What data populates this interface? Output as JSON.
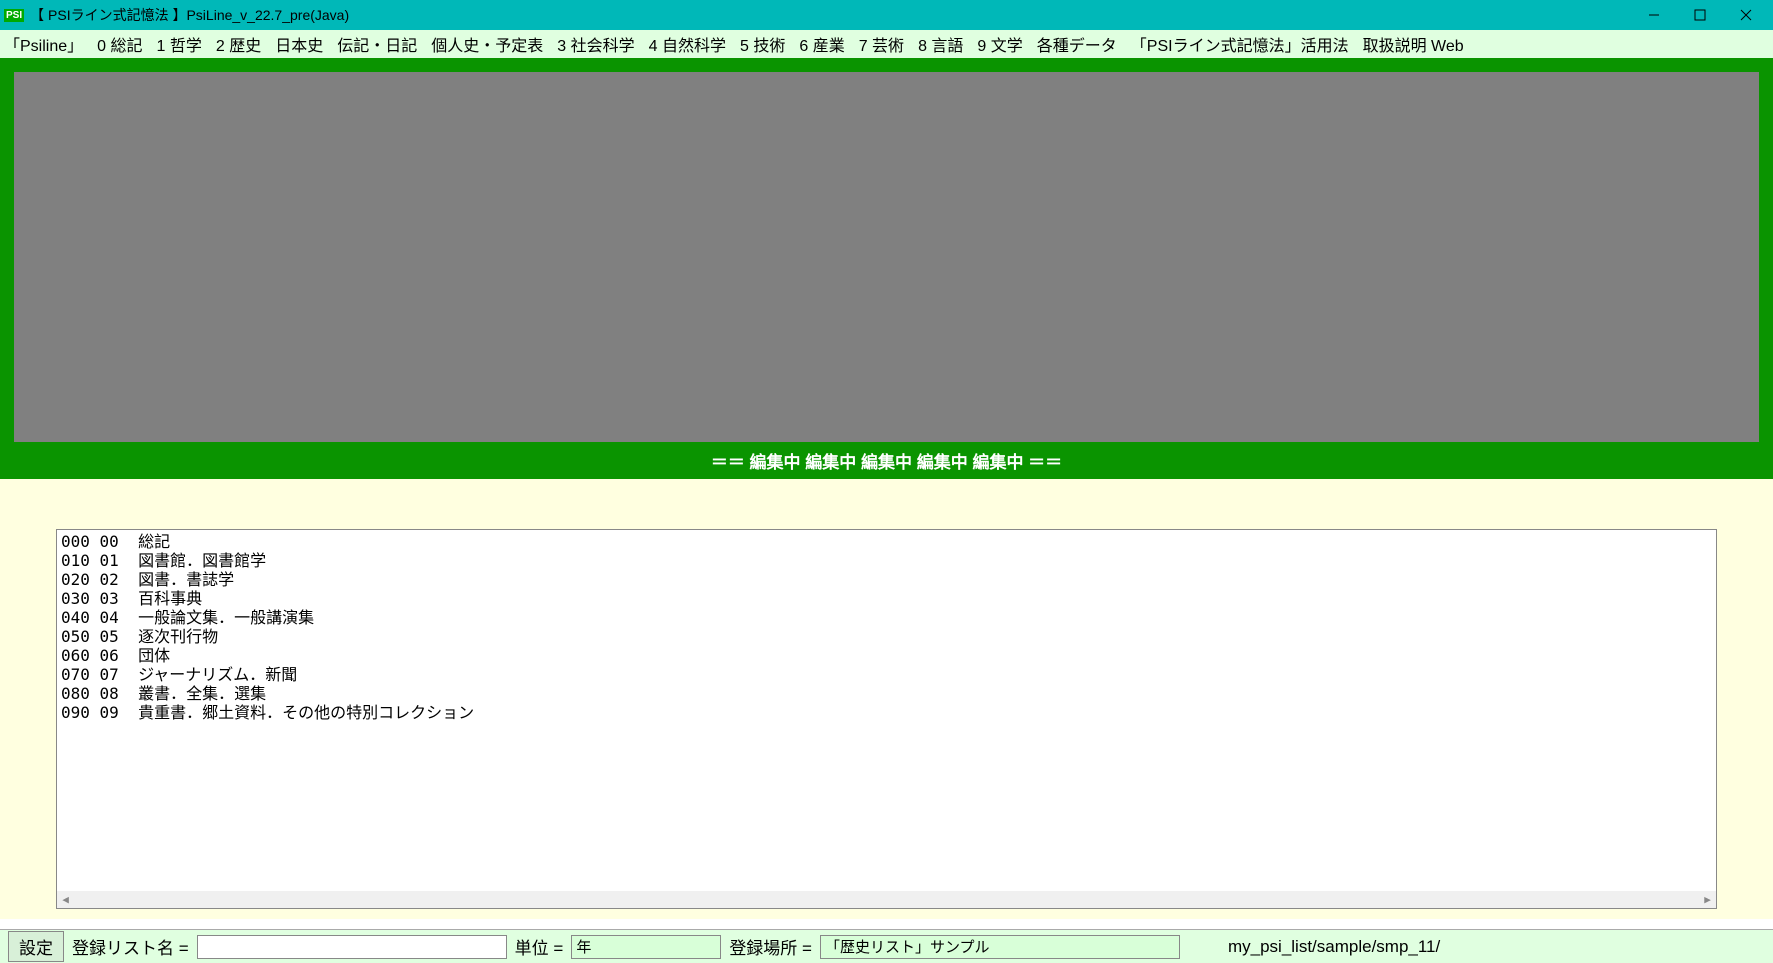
{
  "titlebar": {
    "icon": "PSI",
    "text": "【 PSIライン式記憶法 】PsiLine_v_22.7_pre(Java)"
  },
  "menu": {
    "items": [
      "「Psiline」",
      "0 総記",
      "1 哲学",
      "2 歴史",
      "日本史",
      "伝記・日記",
      "個人史・予定表",
      "3 社会科学",
      "4 自然科学",
      "5 技術",
      "6 産業",
      "7 芸術",
      "8 言語",
      "9 文学",
      "各種データ",
      "「PSIライン式記憶法」活用法",
      "取扱説明 Web"
    ]
  },
  "editbar": "＝＝ 編集中 編集中 編集中 編集中 編集中 ＝＝",
  "textbox": {
    "lines": [
      "000 00  総記",
      "010 01  図書館．図書館学",
      "020 02  図書．書誌学",
      "030 03  百科事典",
      "040 04  一般論文集．一般講演集",
      "050 05  逐次刊行物",
      "060 06  団体",
      "070 07  ジャーナリズム．新聞",
      "080 08  叢書．全集．選集",
      "090 09  貴重書．郷土資料．その他の特別コレクション"
    ]
  },
  "bottom": {
    "settings": "設定",
    "listname_label": "登録リスト名 =",
    "listname_value": "",
    "unit_label": "単位 =",
    "unit_value": "年",
    "loc_label": "登録場所 =",
    "loc_value": "「歴史リスト」サンプル",
    "path": "my_psi_list/sample/smp_11/"
  }
}
